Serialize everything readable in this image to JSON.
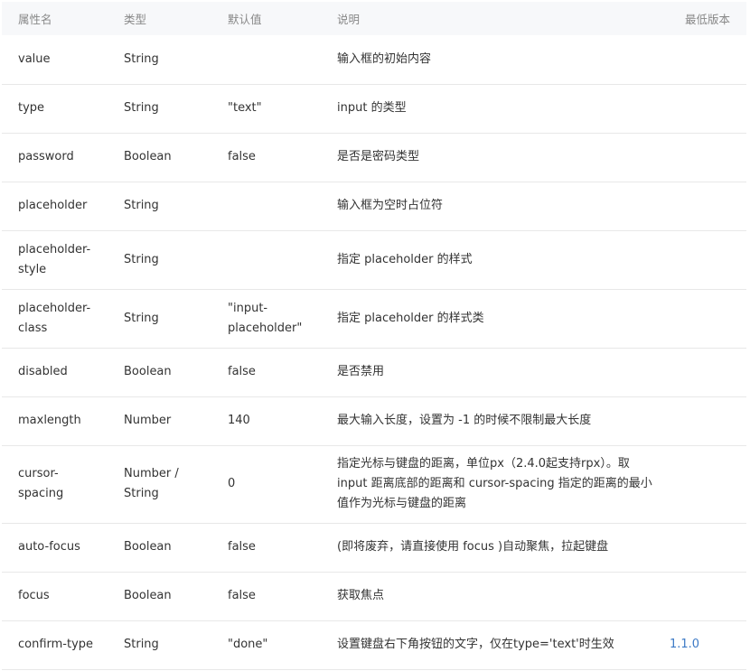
{
  "headers": {
    "name": "属性名",
    "type": "类型",
    "default": "默认值",
    "desc": "说明",
    "version": "最低版本"
  },
  "rows": [
    {
      "name": "value",
      "type": "String",
      "default": "",
      "desc": "输入框的初始内容",
      "version": ""
    },
    {
      "name": "type",
      "type": "String",
      "default": "\"text\"",
      "desc": "input 的类型",
      "version": ""
    },
    {
      "name": "password",
      "type": "Boolean",
      "default": "false",
      "desc": "是否是密码类型",
      "version": ""
    },
    {
      "name": "placeholder",
      "type": "String",
      "default": "",
      "desc": "输入框为空时占位符",
      "version": ""
    },
    {
      "name": "placeholder-style",
      "type": "String",
      "default": "",
      "desc": "指定 placeholder 的样式",
      "version": ""
    },
    {
      "name": "placeholder-class",
      "type": "String",
      "default": "\"input-placeholder\"",
      "desc": "指定 placeholder 的样式类",
      "version": ""
    },
    {
      "name": "disabled",
      "type": "Boolean",
      "default": "false",
      "desc": "是否禁用",
      "version": ""
    },
    {
      "name": "maxlength",
      "type": "Number",
      "default": "140",
      "desc": "最大输入长度，设置为 -1 的时候不限制最大长度",
      "version": ""
    },
    {
      "name": "cursor-spacing",
      "type": "Number / String",
      "default": "0",
      "desc": "指定光标与键盘的距离，单位px（2.4.0起支持rpx）。取 input 距离底部的距离和 cursor-spacing 指定的距离的最小值作为光标与键盘的距离",
      "version": ""
    },
    {
      "name": "auto-focus",
      "type": "Boolean",
      "default": "false",
      "desc": "(即将废弃，请直接使用 focus )自动聚焦，拉起键盘",
      "version": ""
    },
    {
      "name": "focus",
      "type": "Boolean",
      "default": "false",
      "desc": "获取焦点",
      "version": ""
    },
    {
      "name": "confirm-type",
      "type": "String",
      "default": "\"done\"",
      "desc": "设置键盘右下角按钮的文字，仅在type='text'时生效",
      "version": "1.1.0"
    }
  ]
}
